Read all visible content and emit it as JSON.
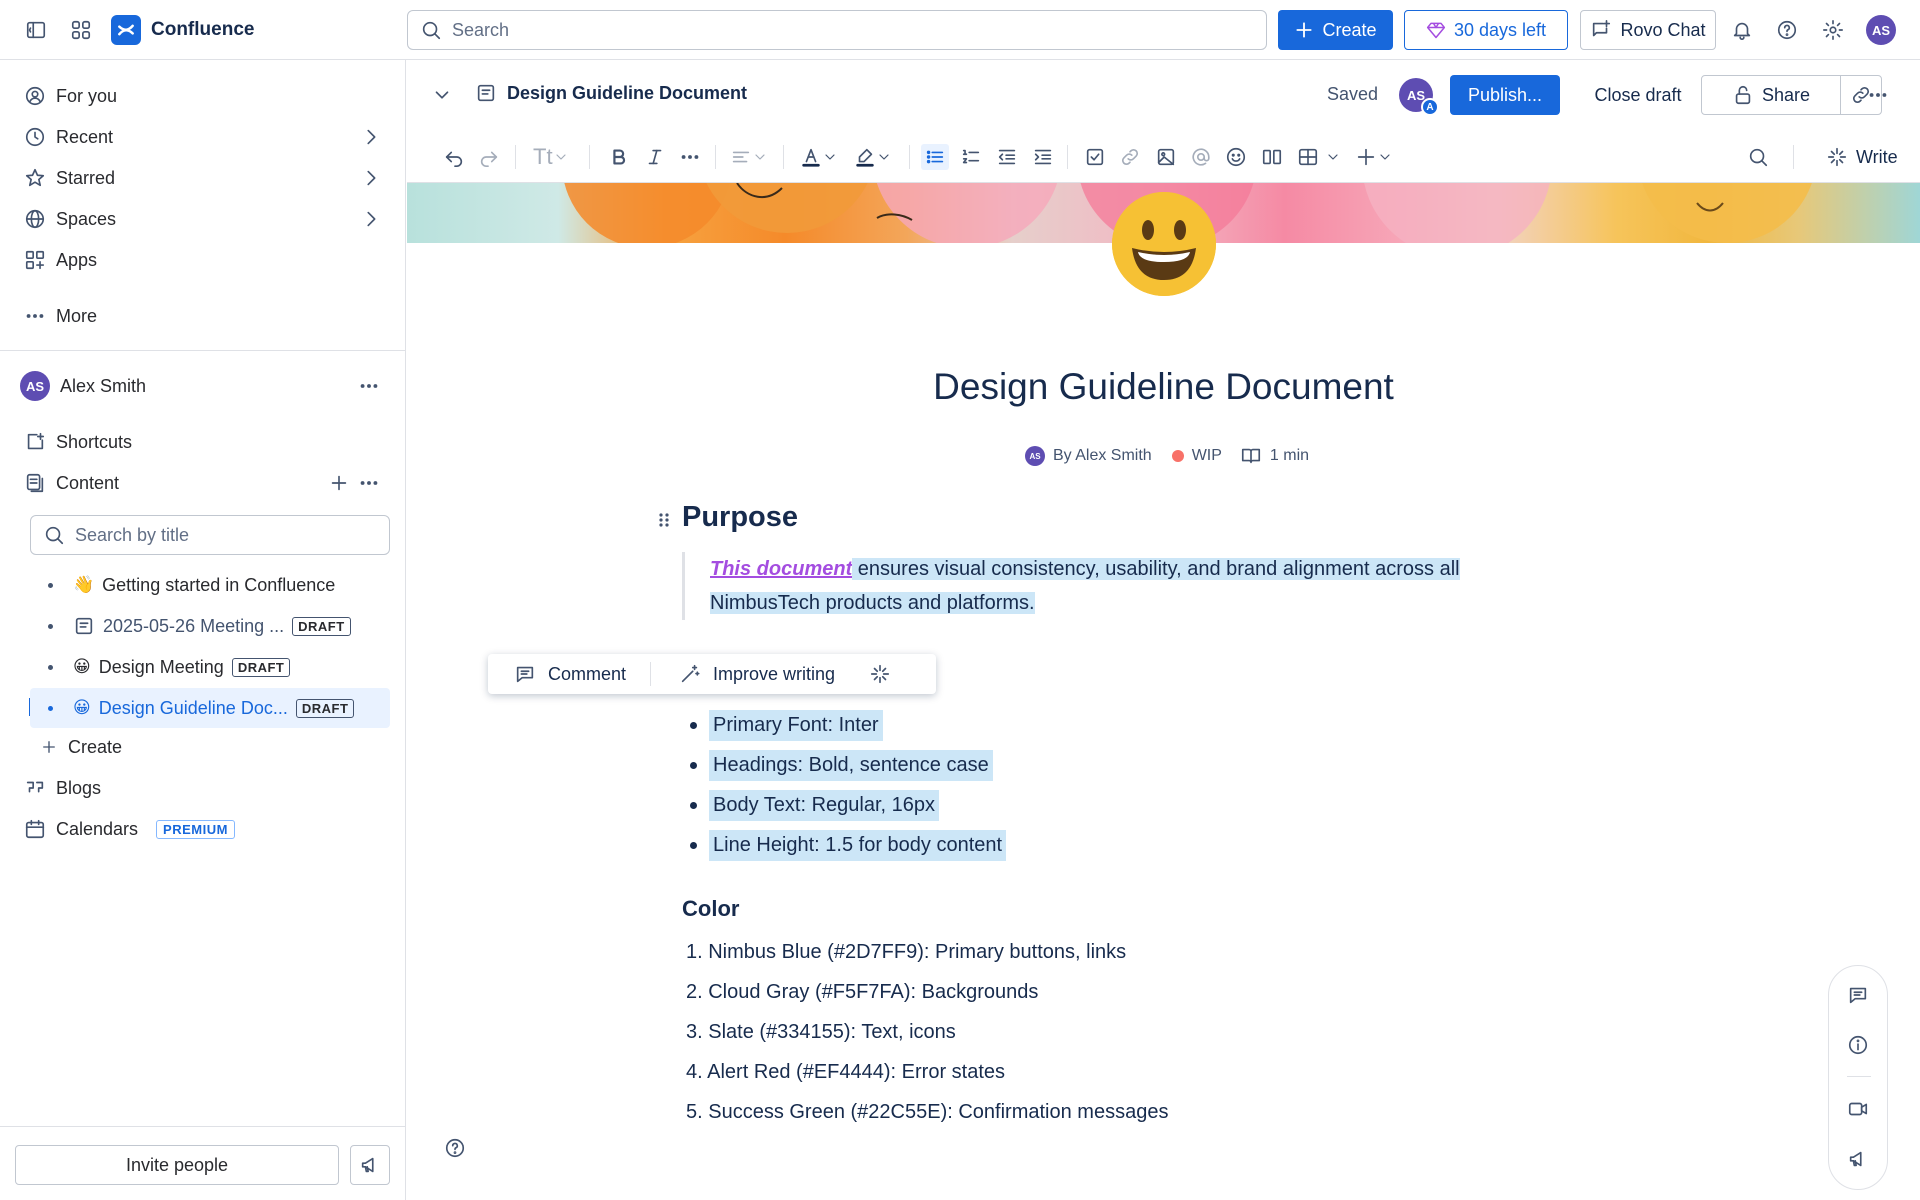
{
  "topbar": {
    "app_name": "Confluence",
    "search_placeholder": "Search",
    "create_label": "Create",
    "trial_label": "30 days left",
    "rovo_label": "Rovo Chat",
    "avatar_initials": "AS"
  },
  "sidebar": {
    "nav": [
      {
        "label": "For you",
        "icon": "user-circle-icon"
      },
      {
        "label": "Recent",
        "icon": "clock-icon"
      },
      {
        "label": "Starred",
        "icon": "star-icon"
      },
      {
        "label": "Spaces",
        "icon": "globe-icon"
      },
      {
        "label": "Apps",
        "icon": "apps-icon"
      },
      {
        "label": "More",
        "icon": "more-icon"
      }
    ],
    "space": {
      "name": "Alex Smith",
      "initials": "AS",
      "shortcuts_label": "Shortcuts",
      "content_label": "Content",
      "search_placeholder": "Search by title",
      "tree": [
        {
          "emoji": "👋",
          "label": "Getting started in Confluence",
          "badge": ""
        },
        {
          "emoji": "",
          "label": "2025-05-26 Meeting ...",
          "badge": "DRAFT"
        },
        {
          "emoji": "😀",
          "label": "Design Meeting",
          "badge": "DRAFT"
        },
        {
          "emoji": "😀",
          "label": "Design Guideline Doc...",
          "badge": "DRAFT"
        }
      ],
      "create_label": "Create",
      "blogs_label": "Blogs",
      "calendars_label": "Calendars",
      "premium_label": "PREMIUM"
    },
    "invite_label": "Invite people"
  },
  "page": {
    "breadcrumb_title": "Design Guideline Document",
    "saved_label": "Saved",
    "publish_label": "Publish...",
    "close_draft_label": "Close draft",
    "share_label": "Share",
    "write_label": "Write",
    "avatar_initials": "AS",
    "avatar_badge": "A"
  },
  "doc": {
    "title": "Design Guideline Document",
    "byline_initials": "AS",
    "byline_author": "By Alex Smith",
    "status": "WIP",
    "read_time": "1 min",
    "purpose_heading": "Purpose",
    "purpose_link": "This document",
    "purpose_text_1": " ensures visual consistency, usability, and brand alignment across all",
    "purpose_text_2": "NimbusTech products and platforms.",
    "popup": {
      "comment": "Comment",
      "improve": "Improve writing"
    },
    "typography": [
      "Primary Font: Inter",
      "Headings: Bold, sentence case",
      "Body Text: Regular, 16px",
      "Line Height: 1.5 for body content"
    ],
    "color_heading": "Color",
    "colors": [
      "1. Nimbus Blue (#2D7FF9): Primary buttons, links",
      "2. Cloud Gray (#F5F7FA): Backgrounds",
      "3. Slate (#334155): Text, icons",
      "4. Alert Red (#EF4444): Error states",
      "5. Success Green (#22C55E): Confirmation messages"
    ]
  },
  "theme": {
    "brand": "#1868db",
    "avatar": "#5e4db2",
    "highlight": "#cce6f7",
    "status_dot": "#f87168"
  }
}
